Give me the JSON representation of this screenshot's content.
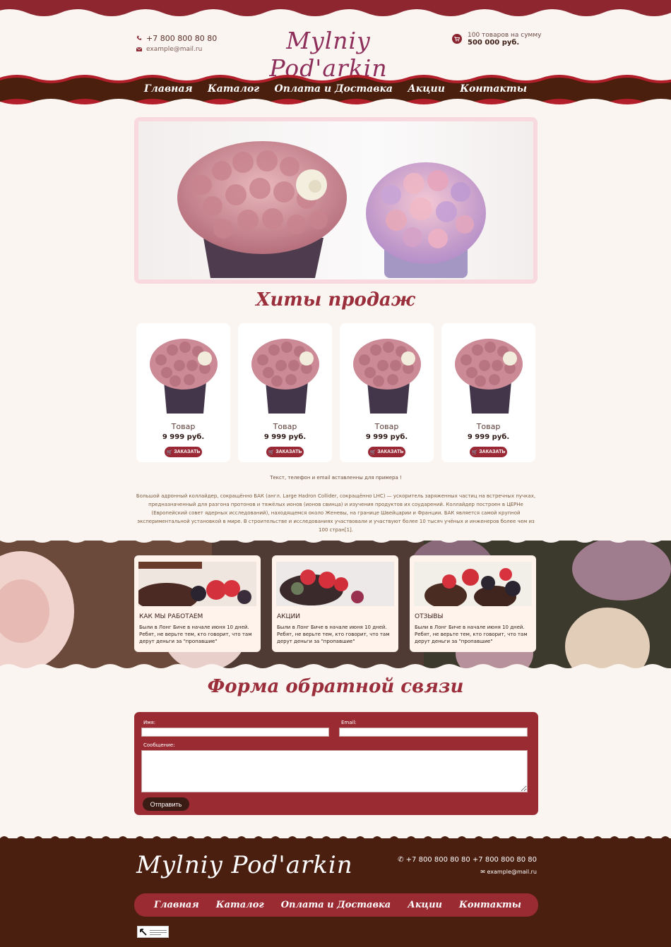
{
  "header": {
    "phone": "+7 800 800 80 80",
    "email": "example@mail.ru",
    "logo": "Mylniy Pod'arkin",
    "cart_line1": "100 товаров на сумму",
    "cart_line2": "500 000 руб."
  },
  "nav": [
    "Главная",
    "Каталог",
    "Оплата и Доставка",
    "Акции",
    "Контакты"
  ],
  "hits": {
    "title": "Хиты продаж",
    "products": [
      {
        "name": "Товар",
        "price": "9 999 руб.",
        "button": "ЗАКАЗАТЬ"
      },
      {
        "name": "Товар",
        "price": "9 999 руб.",
        "button": "ЗАКАЗАТЬ"
      },
      {
        "name": "Товар",
        "price": "9 999 руб.",
        "button": "ЗАКАЗАТЬ"
      },
      {
        "name": "Товар",
        "price": "9 999 руб.",
        "button": "ЗАКАЗАТЬ"
      }
    ]
  },
  "note": "Текст, телефон и email вставленны для примера !",
  "paragraph": "Большой адронный коллайдер, сокращённо БАК (англ. Large Hadron Collider, сокращённо LHC) — ускоритель заряженных частиц на встречных пучках, предназначенный для разгона протонов и тяжёлых ионов (ионов свинца) и изучения продуктов их соударений. Коллайдер построен в ЦЕРНе (Европейский совет ядерных исследований), находящемся около Женевы, на границе Швейцарии и Франции. БАК является самой крупной экспериментальной установкой в мире. В строительстве и исследованиях участвовали и участвуют более 10 тысяч учёных и инженеров более чем из 100 стран[1].",
  "info_cards": [
    {
      "title": "КАК МЫ РАБОТАЕМ",
      "text": "Были в Лонг Биче в начале июня 10 дней. Ребят, не верьте тем, кто говорит, что там дерут деньги за \"пропавшие\""
    },
    {
      "title": "АКЦИИ",
      "text": "Были в Лонг Биче в начале июня 10 дней. Ребят, не верьте тем, кто говорит, что там дерут деньги за \"пропавшие\""
    },
    {
      "title": "ОТЗЫВЫ",
      "text": "Были в Лонг Биче в начале июня 10 дней. Ребят, не верьте тем, кто говорит, что там дерут деньги за \"пропавшие\""
    }
  ],
  "form": {
    "title": "Форма обратной связи",
    "name_label": "Имя:",
    "email_label": "Email:",
    "message_label": "Сообщение:",
    "submit": "Отправить"
  },
  "footer": {
    "logo": "Mylniy Pod'arkin",
    "phones": "+7 800 800 80 80   +7 800 800 80 80",
    "email": "example@mail.ru",
    "nav": [
      "Главная",
      "Каталог",
      "Оплата и Доставка",
      "Акции",
      "Контакты"
    ]
  },
  "colors": {
    "brand_red": "#9a2b33",
    "brown": "#4a1f10",
    "logo_purple": "#8d2f5a",
    "background": "#fbf5f2"
  }
}
